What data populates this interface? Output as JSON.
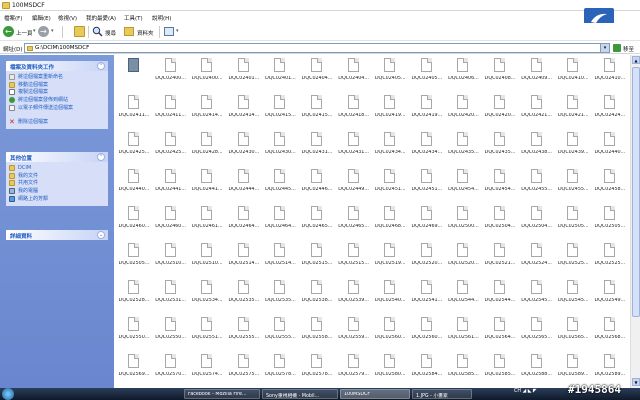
{
  "window": {
    "title": "100MSDCF"
  },
  "menu": [
    "檔案(F)",
    "編輯(E)",
    "檢視(V)",
    "我的最愛(A)",
    "工具(T)",
    "說明(H)"
  ],
  "toolbar": {
    "back_label": "上一頁",
    "search_label": "搜尋",
    "folders_label": "資料夾"
  },
  "address": {
    "label": "網址(D)",
    "path": "G:\\DCIM\\100MSDCF",
    "go_label": "移至"
  },
  "left_pane": {
    "tasks_title": "檔案及資料夾工作",
    "tasks": [
      "將這個檔案重新命名",
      "移動這個檔案",
      "複製這個檔案",
      "將這個檔案發佈到網站",
      "以電子郵件傳送這個檔案",
      "刪除這個檔案"
    ],
    "other_title": "其他位置",
    "other_places": [
      "DCIM",
      "我的文件",
      "共用文件",
      "我的電腦",
      "網路上的芳鄰"
    ],
    "details_title": "詳細資料"
  },
  "files": [
    "",
    "DQC02400...",
    "DQC02400...",
    "DQC02401...",
    "DQC02401...",
    "DQC02404...",
    "DQC02404...",
    "DQC02405...",
    "DQC02405...",
    "DQC02406...",
    "DQC02408...",
    "DQC02409...",
    "DQC02410...",
    "DQC02410...",
    "DQC02411...",
    "DQC02411...",
    "DQC02414...",
    "DQC02414...",
    "DQC02415...",
    "DQC02415...",
    "DQC02418...",
    "DQC02419...",
    "DQC02419...",
    "DQC02420...",
    "DQC02420...",
    "DQC02421...",
    "DQC02421...",
    "DQC02424...",
    "DQC02425...",
    "DQC02425...",
    "DQC02428...",
    "DQC02430...",
    "DQC02430...",
    "DQC02431...",
    "DQC02431...",
    "DQC02434...",
    "DQC02434...",
    "DQC02435...",
    "DQC02435...",
    "DQC02438...",
    "DQC02439...",
    "DQC02440...",
    "DQC02440...",
    "DQC02441...",
    "DQC02441...",
    "DQC02444...",
    "DQC02445...",
    "DQC02446...",
    "DQC02449...",
    "DQC02451...",
    "DQC02451...",
    "DQC02454...",
    "DQC02454...",
    "DQC02455...",
    "DQC02455...",
    "DQC02458...",
    "DQC02460...",
    "DQC02460...",
    "DQC02461...",
    "DQC02464...",
    "DQC02464...",
    "DQC02465...",
    "DQC02465...",
    "DQC02468...",
    "DQC02469...",
    "DQC02500...",
    "DQC02504...",
    "DQC02504...",
    "DQC02505...",
    "DQC02505...",
    "DQC02505...",
    "DQC02510...",
    "DQC02510...",
    "DQC02514...",
    "DQC02514...",
    "DQC02515...",
    "DQC02515...",
    "DQC02519...",
    "DQC02520...",
    "DQC02520...",
    "DQC02521...",
    "DQC02524...",
    "DQC02525...",
    "DQC02525...",
    "DQC02528...",
    "DQC02531...",
    "DQC02534...",
    "DQC02535...",
    "DQC02535...",
    "DQC02538...",
    "DQC02539...",
    "DQC02540...",
    "DQC02541...",
    "DQC02544...",
    "DQC02544...",
    "DQC02545...",
    "DQC02545...",
    "DQC02549...",
    "DQC02550...",
    "DQC02550...",
    "DQC02551...",
    "DQC02555...",
    "DQC02555...",
    "DQC02558...",
    "DQC02559...",
    "DQC02560...",
    "DQC02560...",
    "DQC02561...",
    "DQC02564...",
    "DQC02565...",
    "DQC02565...",
    "DQC02568...",
    "DQC02569...",
    "DQC02570...",
    "DQC02574...",
    "DQC02575...",
    "DQC02578...",
    "DQC02578...",
    "DQC02579...",
    "DQC02580...",
    "DQC02584...",
    "DQC02585...",
    "DQC02585...",
    "DQC02588...",
    "DQC02589...",
    "DQC02589..."
  ],
  "taskbar": {
    "buttons": [
      "Facebook - Mozilla Fire...",
      "Sony重視相機 - Mobil...",
      "100MSDCF",
      "1.JPG - 小畫家"
    ],
    "tray": "CH  ◢ ◣ ◤"
  },
  "watermark": "#1945864",
  "colors": {
    "taskpane": "#6a86cf",
    "link": "#215dc6",
    "taskbar": "#1a2a40"
  }
}
